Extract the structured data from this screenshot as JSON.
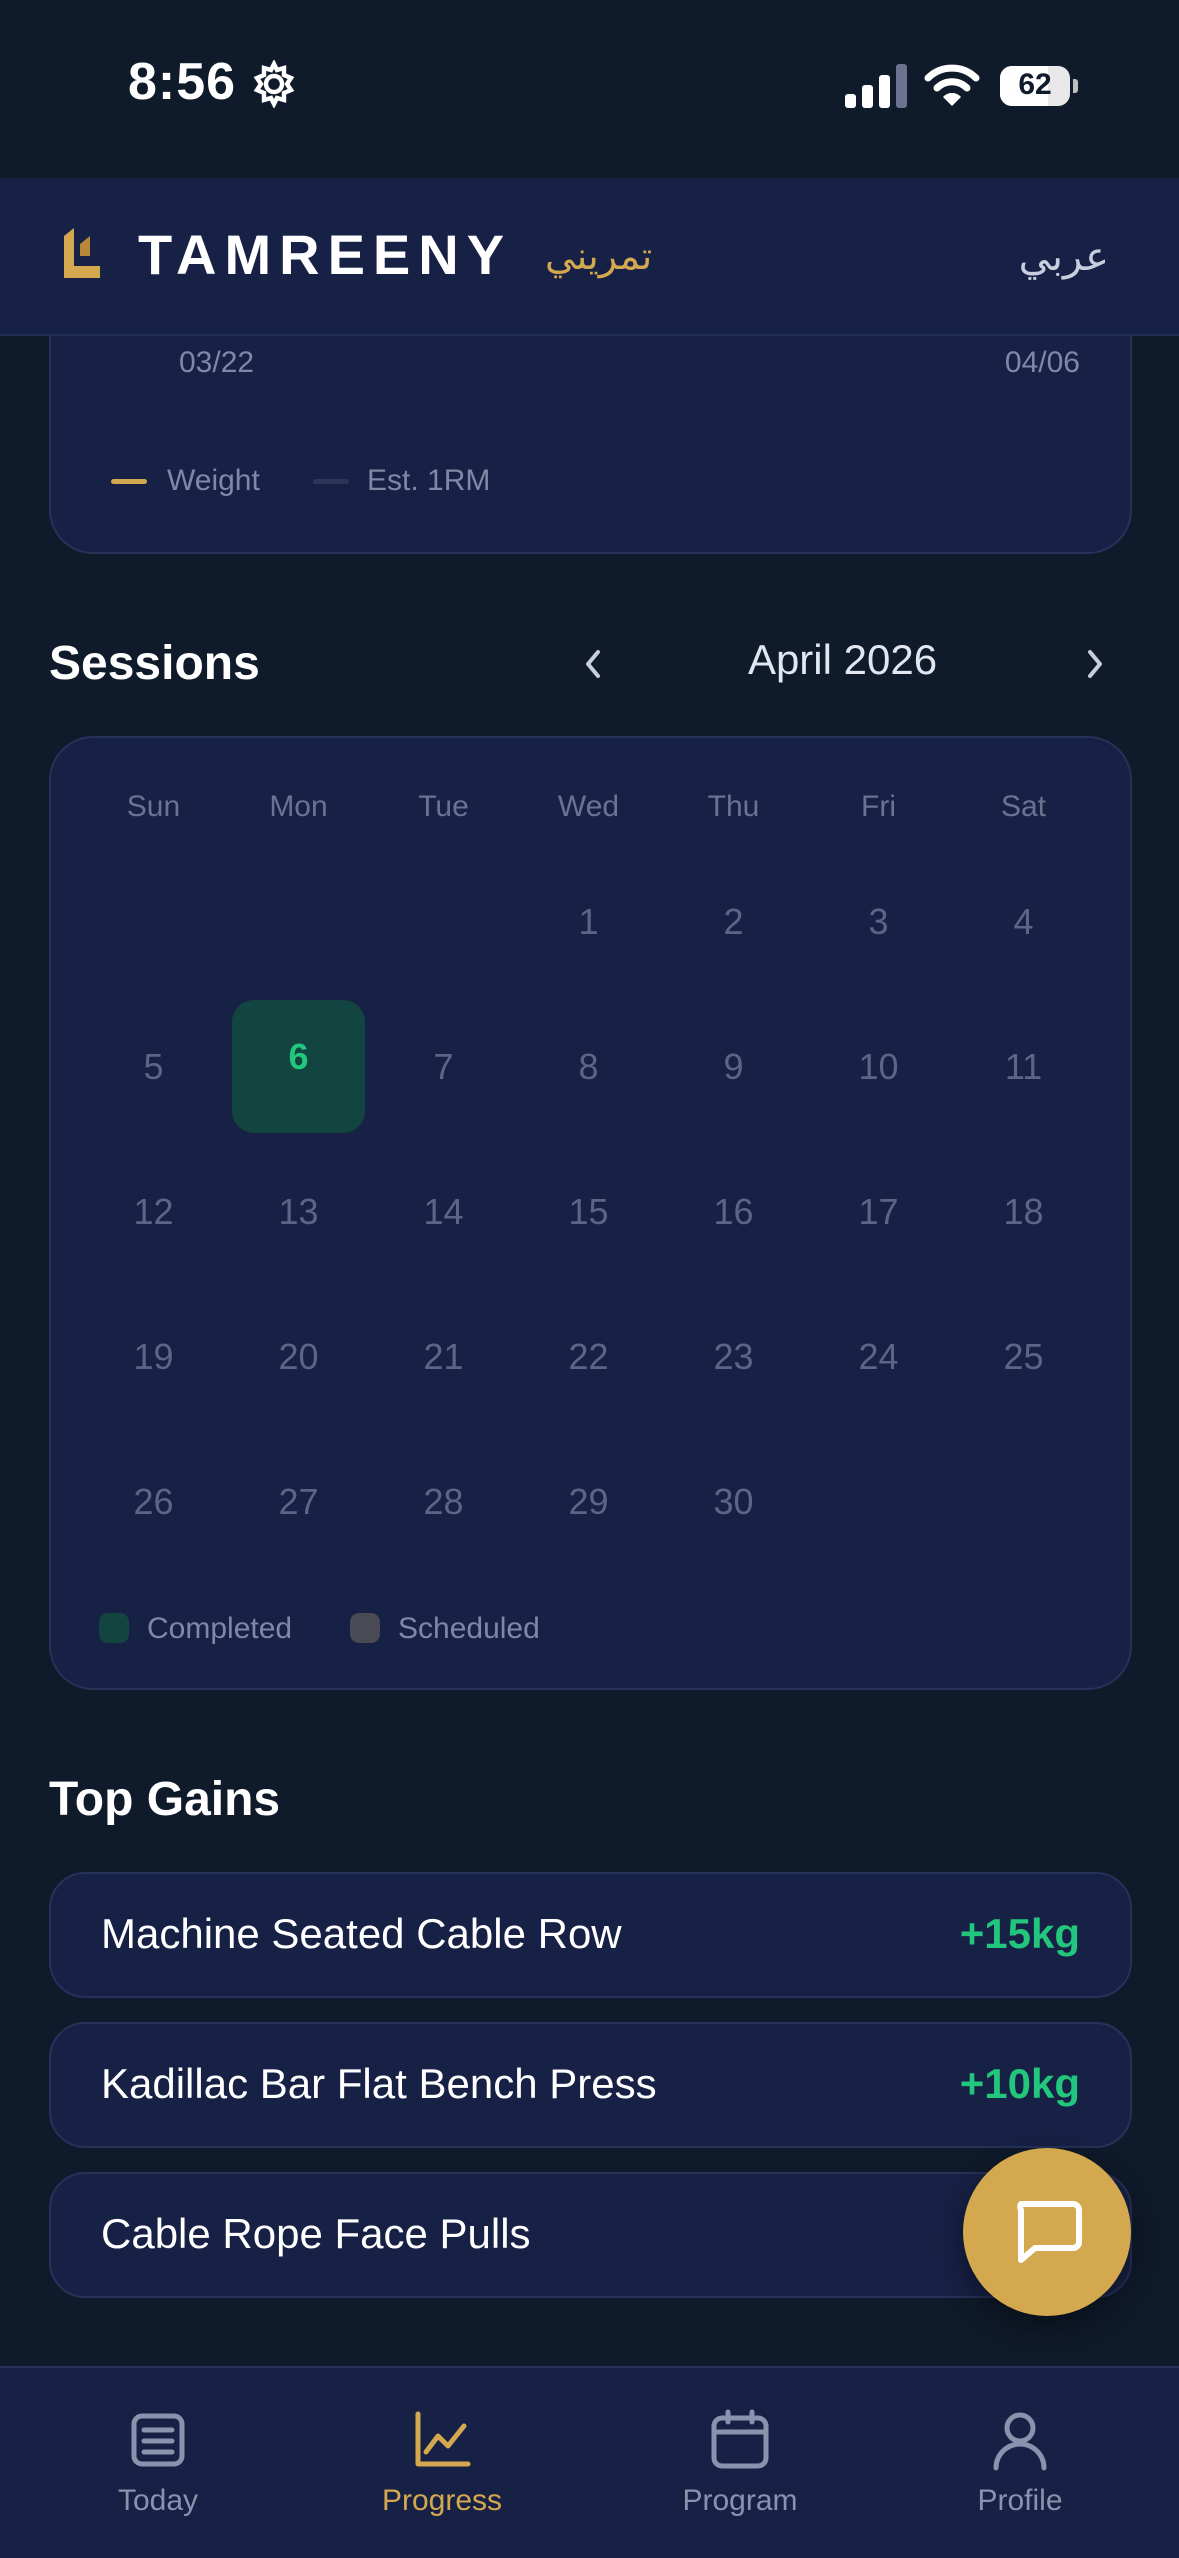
{
  "status_bar": {
    "time": "8:56",
    "battery": "62",
    "icons": [
      "settings-gear-icon",
      "cellular-signal-icon",
      "wifi-icon",
      "battery-icon"
    ]
  },
  "header": {
    "brand": "TAMREENY",
    "brand_arabic": "تمريني",
    "language_toggle": "عربي",
    "logo_icon": "tamreeny-logo-icon"
  },
  "chart_card": {
    "x_start": "03/22",
    "x_end": "04/06",
    "legend": [
      {
        "label": "Weight",
        "color": "#d4a84f"
      },
      {
        "label": "Est. 1RM",
        "color": "#2a3558"
      }
    ]
  },
  "sessions": {
    "title": "Sessions",
    "month": "April 2026",
    "prev_icon": "chevron-left-icon",
    "next_icon": "chevron-right-icon",
    "weekdays": [
      "Sun",
      "Mon",
      "Tue",
      "Wed",
      "Thu",
      "Fri",
      "Sat"
    ],
    "days": [
      "1",
      "2",
      "3",
      "4",
      "5",
      "6",
      "7",
      "8",
      "9",
      "10",
      "11",
      "12",
      "13",
      "14",
      "15",
      "16",
      "17",
      "18",
      "19",
      "20",
      "21",
      "22",
      "23",
      "24",
      "25",
      "26",
      "27",
      "28",
      "29",
      "30"
    ],
    "completed_day": "6",
    "legend": {
      "completed": "Completed",
      "scheduled": "Scheduled",
      "completed_color": "#124440",
      "scheduled_color": "#4a4a55"
    }
  },
  "top_gains": {
    "title": "Top Gains",
    "items": [
      {
        "name": "Machine Seated Cable Row",
        "gain": "+15kg"
      },
      {
        "name": "Kadillac Bar Flat Bench Press",
        "gain": "+10kg"
      },
      {
        "name": "Cable Rope Face Pulls",
        "gain": ""
      }
    ]
  },
  "fab": {
    "icon": "chat-bubble-icon"
  },
  "bottom_nav": {
    "active_color": "#d4a84f",
    "inactive_color": "#8a93ad",
    "items": [
      {
        "label": "Today",
        "icon": "today-list-icon"
      },
      {
        "label": "Progress",
        "icon": "chart-line-icon"
      },
      {
        "label": "Program",
        "icon": "calendar-icon"
      },
      {
        "label": "Profile",
        "icon": "user-profile-icon"
      }
    ]
  }
}
